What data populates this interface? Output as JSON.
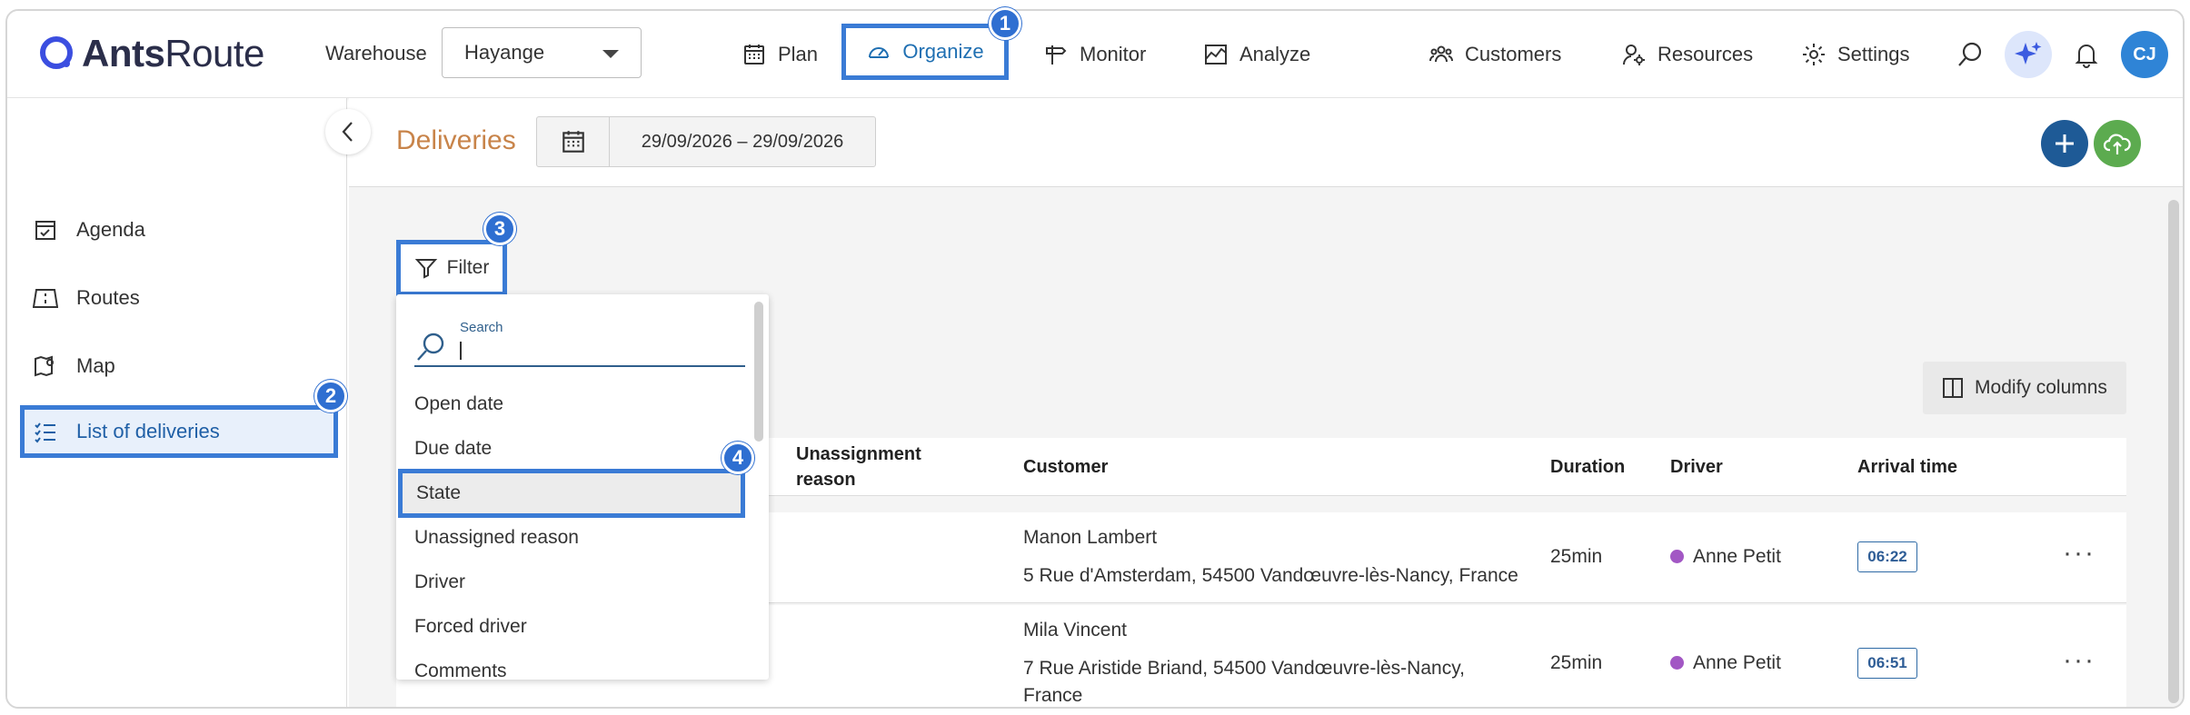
{
  "header": {
    "logo": {
      "bold": "Ants",
      "light": "Route"
    },
    "warehouse_label": "Warehouse",
    "warehouse_value": "Hayange",
    "nav": [
      {
        "label": "Plan",
        "icon": "calendar-grid-icon"
      },
      {
        "label": "Organize",
        "icon": "speedometer-icon",
        "active": true
      },
      {
        "label": "Monitor",
        "icon": "signpost-icon"
      },
      {
        "label": "Analyze",
        "icon": "chart-area-icon"
      },
      {
        "label": "Customers",
        "icon": "users-group-icon"
      },
      {
        "label": "Resources",
        "icon": "user-gear-icon"
      },
      {
        "label": "Settings",
        "icon": "gear-icon"
      }
    ],
    "avatar_initials": "CJ"
  },
  "sidebar": {
    "items": [
      {
        "label": "Agenda",
        "icon": "calendar-check-icon"
      },
      {
        "label": "Routes",
        "icon": "road-icon"
      },
      {
        "label": "Map",
        "icon": "map-pin-icon"
      },
      {
        "label": "List of deliveries",
        "icon": "checklist-icon",
        "active": true
      }
    ]
  },
  "toolbar": {
    "title": "Deliveries",
    "date_range": "29/09/2026 – 29/09/2026"
  },
  "filter": {
    "label": "Filter",
    "search_label": "Search",
    "options": [
      "Open date",
      "Due date",
      "State",
      "Unassigned reason",
      "Driver",
      "Forced driver",
      "Comments"
    ],
    "highlighted": "State"
  },
  "modify_columns_label": "Modify columns",
  "table": {
    "columns": {
      "unassignment_reason": "Unassignment reason",
      "customer": "Customer",
      "duration": "Duration",
      "driver": "Driver",
      "arrival_time": "Arrival time"
    },
    "rows": [
      {
        "customer_name": "Manon Lambert",
        "address_line1": "5 Rue d'Amsterdam, 54500 Vandœuvre-lès-Nancy, France",
        "address_line2": "",
        "duration": "25min",
        "driver": "Anne Petit",
        "arrival": "06:22"
      },
      {
        "customer_name": "Mila Vincent",
        "address_line1": "7 Rue Aristide Briand, 54500 Vandœuvre-lès-Nancy,",
        "address_line2": "France",
        "duration": "25min",
        "driver": "Anne Petit",
        "arrival": "06:51"
      }
    ]
  },
  "callouts": [
    "1",
    "2",
    "3",
    "4"
  ],
  "colors": {
    "highlight": "#3a7bd5",
    "badge": "#2f6fd1",
    "title": "#c8844a",
    "driver_dot": "#a257c4"
  }
}
